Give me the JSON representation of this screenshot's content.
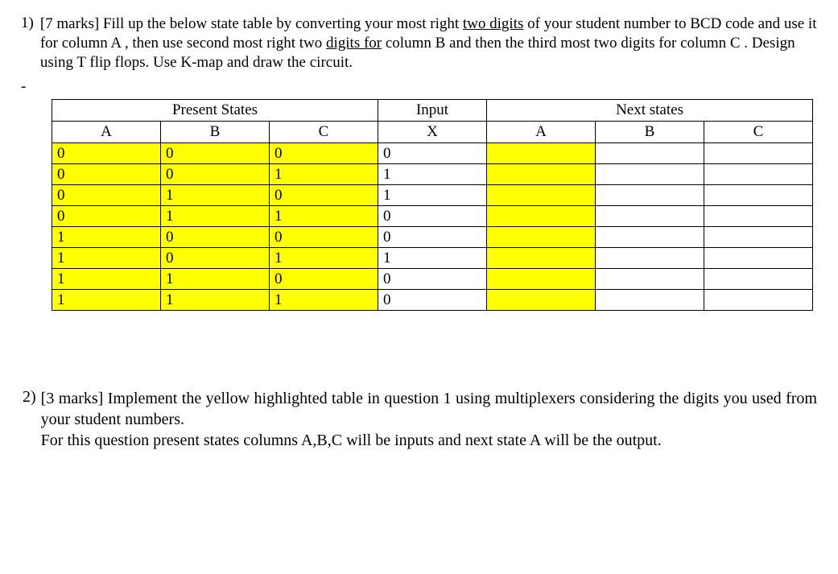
{
  "q1": {
    "number": "1)",
    "marks": "[7 marks]",
    "text_p1": " Fill up the below state table by converting your most right ",
    "text_u1": "two digits",
    "text_p2": " of your student number to BCD code and use it for column A , then use second most right two ",
    "text_u2": "digits for",
    "text_p3": " column B and then the third most two digits for column C . Design using T flip flops. Use K-map and draw the circuit."
  },
  "dash": "-",
  "headers": {
    "present": "Present States",
    "input": "Input",
    "next": "Next states",
    "A": "A",
    "B": "B",
    "C": "C",
    "X": "X"
  },
  "rows": [
    {
      "A": "0",
      "B": "0",
      "C": "0",
      "X": "0"
    },
    {
      "A": "0",
      "B": "0",
      "C": "1",
      "X": "1"
    },
    {
      "A": "0",
      "B": "1",
      "C": "0",
      "X": "1"
    },
    {
      "A": "0",
      "B": "1",
      "C": "1",
      "X": "0"
    },
    {
      "A": "1",
      "B": "0",
      "C": "0",
      "X": "0"
    },
    {
      "A": "1",
      "B": "0",
      "C": "1",
      "X": "1"
    },
    {
      "A": "1",
      "B": "1",
      "C": "0",
      "X": "0"
    },
    {
      "A": "1",
      "B": "1",
      "C": "1",
      "X": "0"
    }
  ],
  "q2": {
    "number": "2)",
    "marks": "[3 marks]",
    "line1": " Implement the yellow highlighted table in question 1 using multiplexers considering the digits you used from your student numbers.",
    "line3a": "For this question present states columns A,B,C  will be inputs and next state A will be the output."
  }
}
